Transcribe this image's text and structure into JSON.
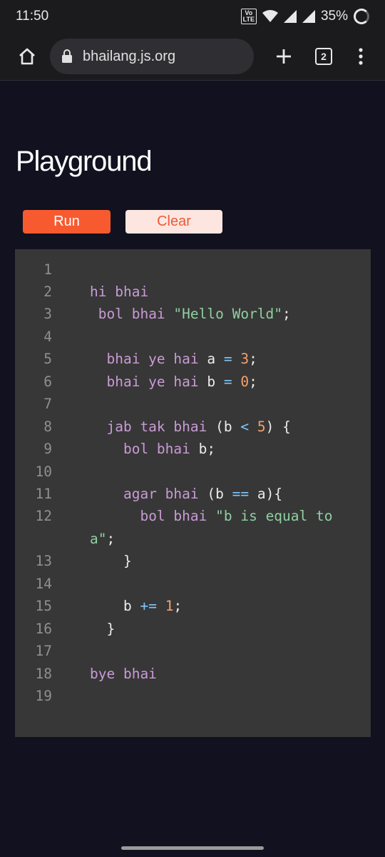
{
  "status_bar": {
    "time": "11:50",
    "network_badge": "Vo LTE 1",
    "battery": "35%"
  },
  "browser": {
    "url": "bhailang.js.org",
    "tab_count": "2",
    "icons": [
      "home-icon",
      "lock-icon",
      "plus-icon",
      "tabs-icon",
      "more-vert-icon"
    ]
  },
  "page": {
    "title": "Playground",
    "run_label": "Run",
    "clear_label": "Clear",
    "colors": {
      "run_bg": "#f85a30",
      "clear_bg": "#fde6e0",
      "clear_text": "#ee5a3a",
      "editor_bg": "#373737",
      "page_bg": "#11111f"
    }
  },
  "editor": {
    "line_numbers": [
      "1",
      "2",
      "3",
      "4",
      "5",
      "6",
      "7",
      "8",
      "9",
      "10",
      "11",
      "12",
      "13",
      "14",
      "15",
      "16",
      "17",
      "18",
      "19"
    ],
    "lines": {
      "l2": {
        "kw": "hi bhai"
      },
      "l3": {
        "kw": "bol bhai",
        "str": "\"Hello World\"",
        "end": ";"
      },
      "l5": {
        "kw": "bhai ye hai",
        "name": "a",
        "op": "=",
        "num": "3",
        "end": ";"
      },
      "l6": {
        "kw": "bhai ye hai",
        "name": "b",
        "op": "=",
        "num": "0",
        "end": ";"
      },
      "l8": {
        "kw": "jab tak bhai",
        "pre": "(b",
        "op": "<",
        "num": "5",
        "end": ") {"
      },
      "l9": {
        "kw": "bol bhai",
        "end": "b;"
      },
      "l11": {
        "kw": "agar bhai",
        "pre": "(b",
        "op": "==",
        "end": "a){"
      },
      "l12": {
        "kw": "bol bhai",
        "str": "\"b is equal to"
      },
      "l12b": {
        "str": "a\"",
        "end": ";"
      },
      "l13": {
        "end": "}"
      },
      "l15": {
        "name": "b",
        "op": "+=",
        "num": "1",
        "end": ";"
      },
      "l16": {
        "end": "}"
      },
      "l18": {
        "kw": "bye bhai"
      }
    }
  }
}
